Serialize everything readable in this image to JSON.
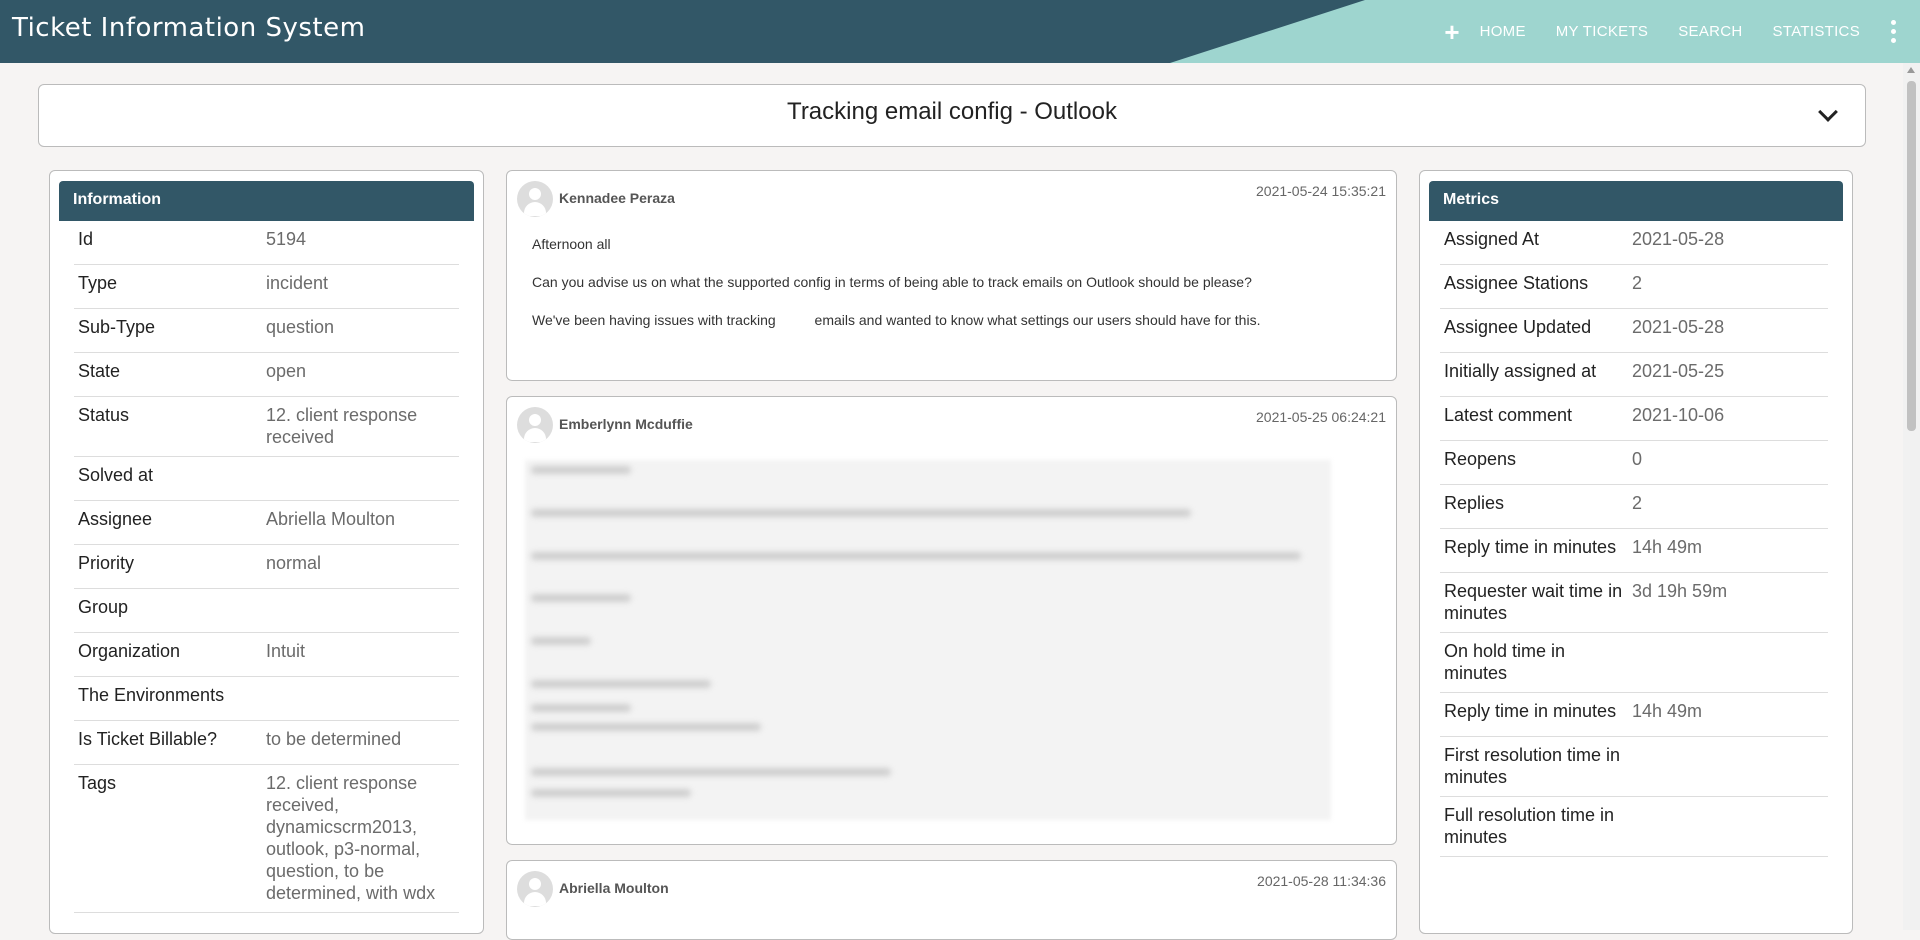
{
  "header": {
    "title": "Ticket Information System",
    "nav": [
      "HOME",
      "MY TICKETS",
      "SEARCH",
      "STATISTICS"
    ],
    "accent_color": "#9ed5cf",
    "bar_color": "#325767"
  },
  "ticket": {
    "title": "Tracking email config - Outlook"
  },
  "info": {
    "heading": "Information",
    "rows": [
      {
        "k": "Id",
        "v": "5194"
      },
      {
        "k": "Type",
        "v": "incident"
      },
      {
        "k": "Sub-Type",
        "v": "question"
      },
      {
        "k": "State",
        "v": "open"
      },
      {
        "k": "Status",
        "v": "12. client response received"
      },
      {
        "k": "Solved at",
        "v": ""
      },
      {
        "k": "Assignee",
        "v": "Abriella Moulton"
      },
      {
        "k": "Priority",
        "v": "normal"
      },
      {
        "k": "Group",
        "v": ""
      },
      {
        "k": "Organization",
        "v": "Intuit"
      },
      {
        "k": "The Environments",
        "v": ""
      },
      {
        "k": "Is Ticket Billable?",
        "v": "to be determined"
      },
      {
        "k": "Tags",
        "v": "12. client response received, dynamicscrm2013, outlook, p3-normal, question, to be determined, with wdx"
      }
    ]
  },
  "metrics": {
    "heading": "Metrics",
    "rows": [
      {
        "k": "Assigned At",
        "v": "2021-05-28"
      },
      {
        "k": "Assignee Stations",
        "v": "2"
      },
      {
        "k": "Assignee Updated",
        "v": "2021-05-28"
      },
      {
        "k": "Initially assigned at",
        "v": "2021-05-25"
      },
      {
        "k": "Latest comment",
        "v": "2021-10-06"
      },
      {
        "k": "Reopens",
        "v": "0"
      },
      {
        "k": "Replies",
        "v": "2"
      },
      {
        "k": "Reply time in minutes",
        "v": "14h 49m"
      },
      {
        "k": "Requester wait time in minutes",
        "v": "3d 19h 59m"
      },
      {
        "k": "On hold time in minutes",
        "v": ""
      },
      {
        "k": "Reply time in minutes",
        "v": "14h 49m"
      },
      {
        "k": "First resolution time in minutes",
        "v": ""
      },
      {
        "k": "Full resolution time in minutes",
        "v": ""
      }
    ]
  },
  "comments": [
    {
      "author": "Kennadee Peraza",
      "time": "2021-05-24 15:35:21",
      "lines": [
        "Afternoon all",
        "Can you advise us on what the supported config in terms of being able to track emails on Outlook should be please?",
        "We've been having issues with tracking          emails and wanted to know what settings our users should have for this."
      ]
    },
    {
      "author": "Emberlynn Mcduffie",
      "time": "2021-05-25 06:24:21"
    },
    {
      "author": "Abriella Moulton",
      "time": "2021-05-28 11:34:36"
    }
  ]
}
